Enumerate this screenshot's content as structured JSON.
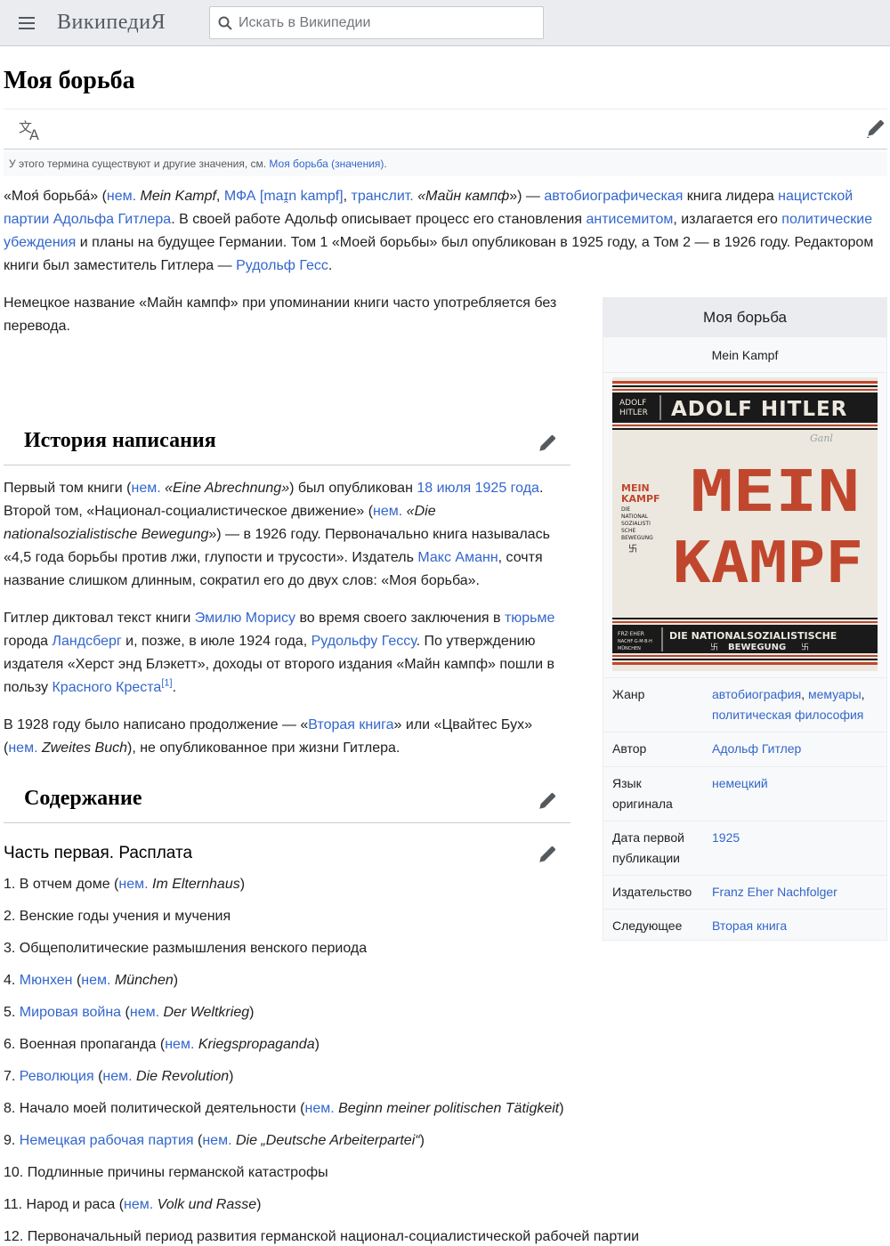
{
  "header": {
    "wordmark": "ВикипедиЯ",
    "search_placeholder": "Искать в Википедии"
  },
  "page_title": "Моя борьба",
  "hatnote": {
    "text": "У этого термина существуют и другие значения, см. ",
    "link": "Моя борьба (значения)",
    "end": "."
  },
  "intro": {
    "p1": {
      "l1a": "«Мoя́ борьба́» (",
      "l1_nem": "нем.",
      "l1b": " ",
      "l1_mk": "Mein Kampf",
      "l1c": ", ",
      "l1_ipa": "МФА [maɪ̯n kampf]",
      "l1d": ", ",
      "l1_translit": "транслит.",
      "l1e": " «",
      "l1_mk2": "Майн кампф",
      "l1f": "») — ",
      "l1_auto": "автобиографическая",
      "l1g": " книга лидера ",
      "l1_nazi": "нацистской",
      "l2_party": "партии Адольфа Гитлера",
      "l2a": ". В своей работе Адольф описывает процесс его становления ",
      "l2_anti": "антисемитом",
      "l2b": ", излагается его ",
      "l2_pol": "политические",
      "l3_ub": "убеждения",
      "l3a": " и планы на будущее Германии. Том 1 «Моей борьбы» был опубликован в 1925 году, а Том 2 — в 1926 году. Редактором",
      "l4a": "книги был заместитель Гитлера — ",
      "l4_hess": "Рудольф Гесс",
      "l4b": "."
    },
    "p2_l1": "Немецкое название «Майн кампф» при упоминании книги часто употребляется без",
    "p2_l2": "перевода."
  },
  "section_history": {
    "title": "История написания",
    "p1": {
      "a1": "Первый том книги (",
      "nem1": "нем.",
      "i1": " «Eine Abrechnung»",
      "a2": ") был опубликован ",
      "date": "18 июля 1925 года",
      "a3": ".",
      "b1": "Второй том, «Национал-социалистическое движение» (",
      "nem2": "нем.",
      "i2": " «Die",
      "c_i": "nationalsozialistische Bewegung",
      "c1": "») — в 1926 году. Первоначально книга называлась",
      "d1": "«4,5 года борьбы против лжи, глупости и трусости». Издатель ",
      "amann": "Макс Аманн",
      "d2": ", сочтя",
      "e1": "название слишком длинным, сократил его до двух слов: «Моя борьба»."
    },
    "p2": {
      "a1": "Гитлер диктовал текст книги ",
      "maurice": "Эмилю Морису",
      "a2": " во время своего заключения в ",
      "prison": "тюрьме",
      "b1": "города ",
      "landsberg": "Ландсберг",
      "b2": " и, позже, в июле 1924 года, ",
      "hess": "Рудольфу Гессу",
      "b3": ". По утверждению",
      "c1": "издателя «Херст энд Блэкетт», доходы от второго издания «Майн кампф» пошли в",
      "d1": "пользу ",
      "redcross": "Красного Креста",
      "ref": "[1]",
      "d2": "."
    },
    "p3": {
      "a1": "В 1928 году было написано продолжение — «",
      "second": "Вторая книга",
      "a2": "» или «Цвайтес Бух»",
      "b1": "(",
      "nem": "нем.",
      "bi": " Zweites Buch",
      "b2": "), не опубликованное при жизни Гитлера."
    }
  },
  "section_content": {
    "title": "Содержание",
    "part_title": "Часть первая. Расплата",
    "items": [
      {
        "num": "1. ",
        "link": "",
        "pre": "В отчем доме (",
        "nem": "нем.",
        "de": " Im Elternhaus",
        "post": ")"
      },
      {
        "num": "2. ",
        "link": "",
        "pre": "Венские годы учения и мучения",
        "nem": "",
        "de": "",
        "post": ""
      },
      {
        "num": "3. ",
        "link": "",
        "pre": "Общеполитические размышления венского периода",
        "nem": "",
        "de": "",
        "post": ""
      },
      {
        "num": "4. ",
        "link": "Мюнхен",
        "pre": " (",
        "nem": "нем.",
        "de": " München",
        "post": ")"
      },
      {
        "num": "5. ",
        "link": "Мировая война",
        "pre": " (",
        "nem": "нем.",
        "de": " Der Weltkrieg",
        "post": ")"
      },
      {
        "num": "6. ",
        "link": "",
        "pre": "Военная пропаганда (",
        "nem": "нем.",
        "de": " Kriegspropaganda",
        "post": ")"
      },
      {
        "num": "7. ",
        "link": "Революция",
        "pre": " (",
        "nem": "нем.",
        "de": " Die Revolution",
        "post": ")"
      },
      {
        "num": "8. ",
        "link": "",
        "pre": "Начало моей политической деятельности (",
        "nem": "нем.",
        "de": " Beginn meiner politischen Tätigkeit",
        "post": ")"
      },
      {
        "num": "9. ",
        "link": "Немецкая рабочая партия",
        "pre": " (",
        "nem": "нем.",
        "de": " Die „Deutsche Arbeiterpartei“",
        "post": ")"
      },
      {
        "num": "10. ",
        "link": "",
        "pre": "Подлинные причины германской катастрофы",
        "nem": "",
        "de": "",
        "post": ""
      },
      {
        "num": "11. ",
        "link": "",
        "pre": "Народ и раса (",
        "nem": "нем.",
        "de": " Volk und Rasse",
        "post": ")"
      },
      {
        "num": "12. ",
        "link": "",
        "pre": "Первоначальный период развития германской национал-социалистической рабочей партии",
        "nem": "",
        "de": "",
        "post": ""
      }
    ]
  },
  "infobox": {
    "title": "Моя борьба",
    "subtitle": "Mein Kampf",
    "cover": {
      "top_small_1": "ADOLF",
      "top_small_2": "HITLER",
      "top_big": "ADOLF HITLER",
      "big_1": "MEIN",
      "big_2": "KAMPF",
      "side_1": "MEIN",
      "side_2": "KAMPF",
      "side_3": "DIE",
      "side_4": "NATIONAL",
      "side_5": "SOZIALISTI",
      "side_6": "SCHE",
      "side_7": "BEWEGUNG",
      "bottom_small_1": "FRZ·EHER",
      "bottom_small_2": "NACHF·G·M·B·H",
      "bottom_small_3": "MÜNCHEN",
      "bottom_1": "DIE NATIONALSOZIALISTISCHE",
      "bottom_2": "BEWEGUNG",
      "pencil": "Ganl",
      "colors": {
        "red": "#c0472e",
        "black": "#1a1a1a",
        "paper": "#ece8df"
      }
    },
    "rows": {
      "genre_label": "Жанр",
      "genre_v1": "автобиография",
      "genre_sep": ", ",
      "genre_v2": "мемуары",
      "genre_sep2": ",",
      "genre_v3": "политическая философия",
      "author_label": "Автор",
      "author_value": "Адольф Гитлер",
      "lang_label_1": "Язык",
      "lang_label_2": "оригинала",
      "lang_value": "немецкий",
      "date_label_1": "Дата первой",
      "date_label_2": "публикации",
      "date_value": "1925",
      "publisher_label": "Издательство",
      "publisher_value": "Franz Eher Nachfolger",
      "next_label": "Следующее",
      "next_value": "Вторая книга"
    }
  }
}
